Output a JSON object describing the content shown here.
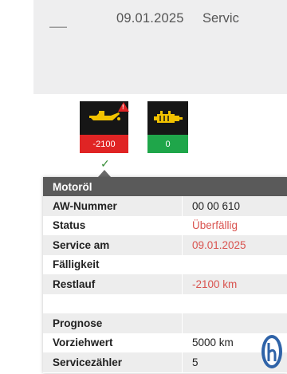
{
  "header": {
    "dash": "—",
    "date": "09.01.2025",
    "service_label": "Servic"
  },
  "tiles": [
    {
      "icon": "oil-can-icon",
      "value": "-2100",
      "status_color": "#e02424",
      "warning": true
    },
    {
      "icon": "ignition-icon",
      "value": "0",
      "status_color": "#1fa64a",
      "warning": false
    }
  ],
  "selected_check": "✓",
  "popup": {
    "title": "Motoröl",
    "rows": [
      {
        "label": "AW-Nummer",
        "value": "00 00 610"
      },
      {
        "label": "Status",
        "value": "Überfällig"
      },
      {
        "label": "Service am",
        "value": "09.01.2025"
      },
      {
        "label": "Fälligkeit",
        "value": ""
      },
      {
        "label": "Restlauf",
        "value": "-2100 km"
      },
      {
        "label": "",
        "value": ""
      },
      {
        "label": "Prognose",
        "value": ""
      },
      {
        "label": "Vorziehwert",
        "value": "5000 km"
      },
      {
        "label": "Servicezähler",
        "value": "5"
      }
    ]
  },
  "colors": {
    "alert": "#d9534f",
    "ok": "#1fa64a",
    "header_bg": "#5a5a5a"
  }
}
